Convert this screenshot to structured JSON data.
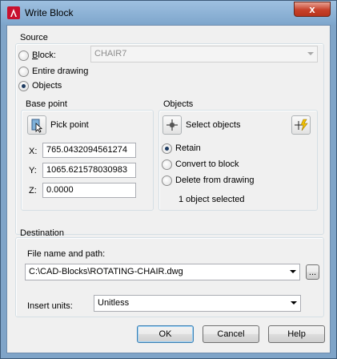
{
  "window": {
    "title": "Write Block",
    "close_glyph": "x"
  },
  "source": {
    "group_label": "Source",
    "block_label": "Block:",
    "block_value": "CHAIR7",
    "entire_drawing_label": "Entire drawing",
    "objects_label": "Objects",
    "selected": "objects"
  },
  "base_point": {
    "group_label": "Base point",
    "pick_point_label": "Pick point",
    "x_label": "X:",
    "x_value": "765.0432094561274",
    "y_label": "Y:",
    "y_value": "1065.621578030983",
    "z_label": "Z:",
    "z_value": "0.0000"
  },
  "objects": {
    "group_label": "Objects",
    "select_objects_label": "Select objects",
    "retain_label": "Retain",
    "convert_label": "Convert to block",
    "delete_label": "Delete from drawing",
    "selected": "retain",
    "status": "1 object selected"
  },
  "destination": {
    "group_label": "Destination",
    "file_label": "File name and path:",
    "file_value": "C:\\CAD-Blocks\\ROTATING-CHAIR.dwg",
    "browse_label": "...",
    "units_label": "Insert units:",
    "units_value": "Unitless"
  },
  "buttons": {
    "ok": "OK",
    "cancel": "Cancel",
    "help": "Help"
  },
  "colors": {
    "titlebar": "#8fb3d8",
    "close": "#c7412a",
    "dialog_bg": "#f0f0f0"
  },
  "icons": [
    "autocad-app-icon",
    "close-icon",
    "pick-point-icon",
    "select-objects-icon",
    "quick-select-icon",
    "dropdown-arrow-icon"
  ]
}
